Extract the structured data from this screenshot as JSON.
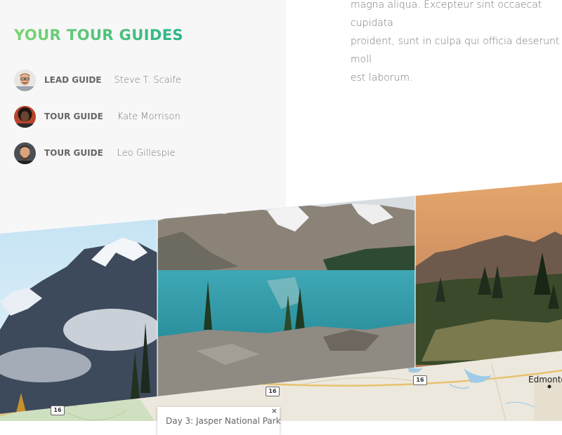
{
  "description": {
    "text": "magna aliqua. Excepteur sint occaecat cupidata\nproident, sunt in culpa qui officia deserunt moll\nest laborum."
  },
  "guides_section": {
    "heading": "YOUR TOUR GUIDES",
    "guides": [
      {
        "role": "LEAD GUIDE",
        "name": "Steve T. Scaife"
      },
      {
        "role": "TOUR GUIDE",
        "name": "Kate Morrison"
      },
      {
        "role": "TOUR GUIDE",
        "name": "Leo Gillespie"
      }
    ]
  },
  "gallery": {
    "images": [
      "mountain-clouds-photo",
      "lake-mountains-photo",
      "sunset-mountains-photo"
    ]
  },
  "map": {
    "road_shields": [
      "16",
      "16",
      "16",
      "16"
    ],
    "city_label": "Edmonto",
    "popup_text": "Day 3: Jasper National Park",
    "close_symbol": "×"
  },
  "colors": {
    "accent_start": "#7dd56f",
    "accent_end": "#28b487",
    "panel_bg": "#f7f7f7"
  }
}
